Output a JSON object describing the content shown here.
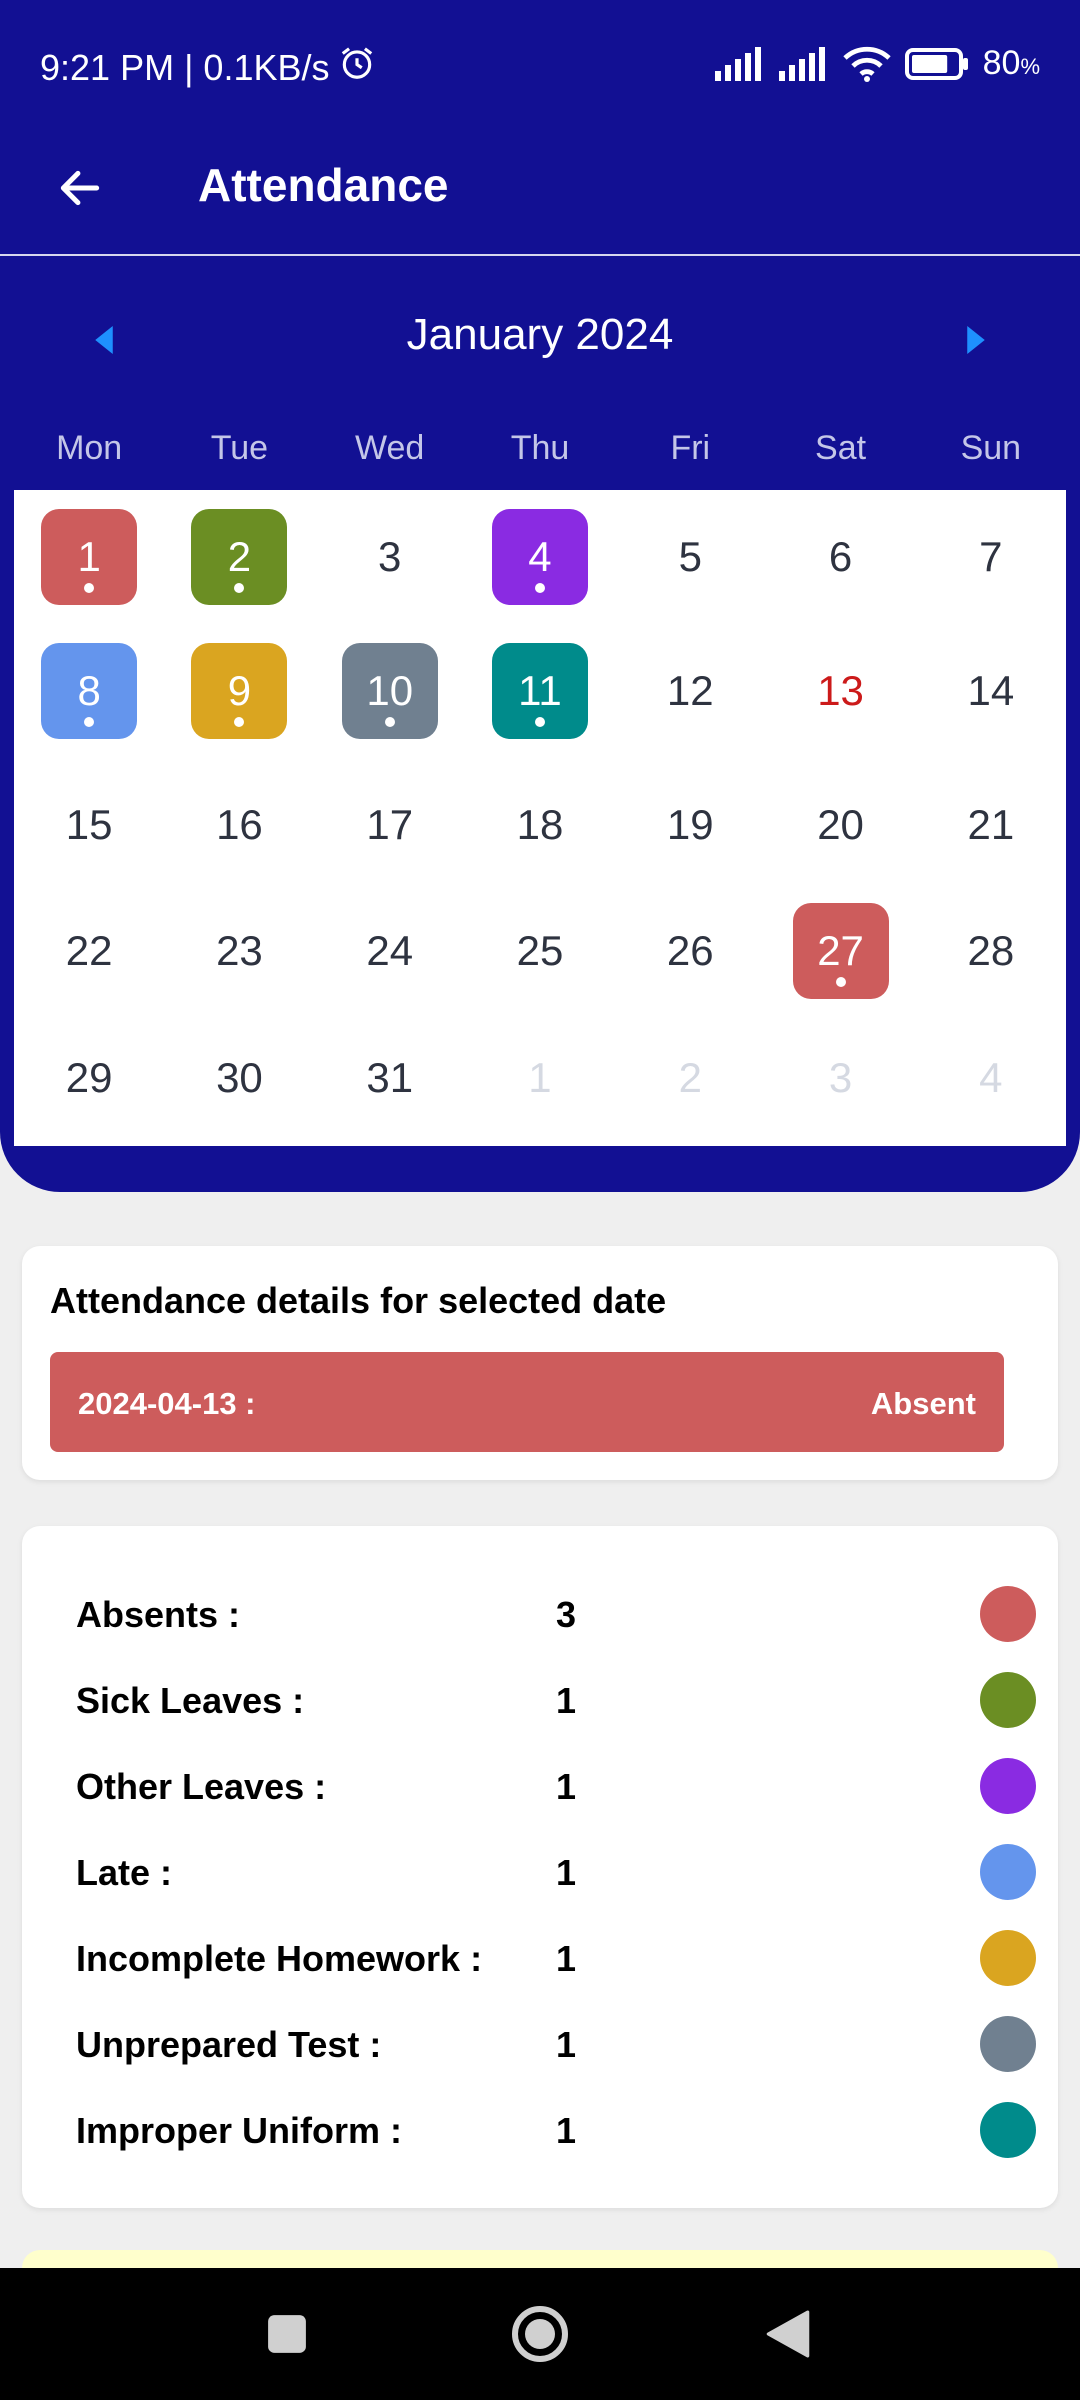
{
  "status_bar": {
    "time_speed": "9:21 PM | 0.1KB/s",
    "battery_value": "80",
    "battery_unit": "%",
    "battery_level": 0.8,
    "icons": [
      "alarm-icon",
      "signal-icon",
      "signal-icon",
      "wifi-icon",
      "battery-icon"
    ]
  },
  "header": {
    "title": "Attendance",
    "back_icon": "arrow-left-icon"
  },
  "calendar": {
    "month_label": "January 2024",
    "weekdays": [
      "Mon",
      "Tue",
      "Wed",
      "Thu",
      "Fri",
      "Sat",
      "Sun"
    ],
    "weeks": [
      [
        {
          "day": "1",
          "status": "absent"
        },
        {
          "day": "2",
          "status": "sick"
        },
        {
          "day": "3"
        },
        {
          "day": "4",
          "status": "other"
        },
        {
          "day": "5"
        },
        {
          "day": "6"
        },
        {
          "day": "7"
        }
      ],
      [
        {
          "day": "8",
          "status": "late"
        },
        {
          "day": "9",
          "status": "homework"
        },
        {
          "day": "10",
          "status": "test"
        },
        {
          "day": "11",
          "status": "uniform"
        },
        {
          "day": "12"
        },
        {
          "day": "13",
          "holiday": true
        },
        {
          "day": "14"
        }
      ],
      [
        {
          "day": "15"
        },
        {
          "day": "16"
        },
        {
          "day": "17"
        },
        {
          "day": "18"
        },
        {
          "day": "19"
        },
        {
          "day": "20"
        },
        {
          "day": "21"
        }
      ],
      [
        {
          "day": "22"
        },
        {
          "day": "23"
        },
        {
          "day": "24"
        },
        {
          "day": "25"
        },
        {
          "day": "26"
        },
        {
          "day": "27",
          "status": "absent"
        },
        {
          "day": "28"
        }
      ],
      [
        {
          "day": "29"
        },
        {
          "day": "30"
        },
        {
          "day": "31"
        },
        {
          "day": "1",
          "outside": true
        },
        {
          "day": "2",
          "outside": true
        },
        {
          "day": "3",
          "outside": true
        },
        {
          "day": "4",
          "outside": true
        }
      ]
    ]
  },
  "details": {
    "heading": "Attendance details for selected date",
    "date": "2024-04-13 :",
    "status": "Absent"
  },
  "summary": [
    {
      "label": "Absents :",
      "count": "3",
      "color": "#cd5c5c"
    },
    {
      "label": "Sick Leaves :",
      "count": "1",
      "color": "#6b8e23"
    },
    {
      "label": "Other Leaves :",
      "count": "1",
      "color": "#8a2be2"
    },
    {
      "label": "Late :",
      "count": "1",
      "color": "#6495ed"
    },
    {
      "label": "Incomplete Homework :",
      "count": "1",
      "color": "#daa520"
    },
    {
      "label": "Unprepared Test :",
      "count": "1",
      "color": "#708090"
    },
    {
      "label": "Improper Uniform :",
      "count": "1",
      "color": "#008b8b"
    }
  ],
  "colors": {
    "primary": "#121093",
    "accent_arrow": "#1e90ff",
    "absent": "#cd5c5c",
    "sick": "#6b8e23",
    "other": "#8a2be2",
    "late": "#6495ed",
    "homework": "#daa520",
    "test": "#708090",
    "uniform": "#008b8b",
    "holiday_text": "#cc1a1a"
  },
  "nav_bar": [
    "recents-square-icon",
    "home-circle-icon",
    "back-triangle-icon"
  ]
}
